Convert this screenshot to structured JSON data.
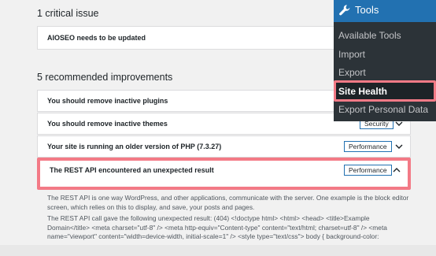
{
  "critical": {
    "heading": "1 critical issue",
    "items": [
      {
        "label": "AIOSEO needs to be updated"
      }
    ]
  },
  "recommended": {
    "heading": "5 recommended improvements",
    "items": [
      {
        "label": "You should remove inactive plugins",
        "badge": ""
      },
      {
        "label": "You should remove inactive themes",
        "badge": "Security"
      },
      {
        "label": "Your site is running an older version of PHP (7.3.27)",
        "badge": "Performance"
      },
      {
        "label": "The REST API encountered an unexpected result",
        "badge": "Performance"
      }
    ],
    "expanded_text": [
      "The REST API is one way WordPress, and other applications, communicate with the server. One example is the block editor screen, which relies on this to display, and save, your posts and pages.",
      "The REST API call gave the following unexpected result: (404) <!doctype html> <html> <head> <title>Example Domain</title> <meta charset=\"utf-8\" /> <meta http-equiv=\"Content-type\" content=\"text/html; charset=utf-8\" /> <meta name=\"viewport\" content=\"width=device-width, initial-scale=1\" /> <style type=\"text/css\"> body { background-color:"
    ]
  },
  "menu": {
    "title": "Tools",
    "icon": "wrench-icon",
    "items": [
      {
        "label": "Available Tools"
      },
      {
        "label": "Import"
      },
      {
        "label": "Export"
      },
      {
        "label": "Site Health"
      },
      {
        "label": "Export Personal Data"
      }
    ],
    "active_index": 3
  },
  "colors": {
    "accent": "#2271b1",
    "highlight": "#f37a86",
    "menu_bg": "#2c3338"
  }
}
